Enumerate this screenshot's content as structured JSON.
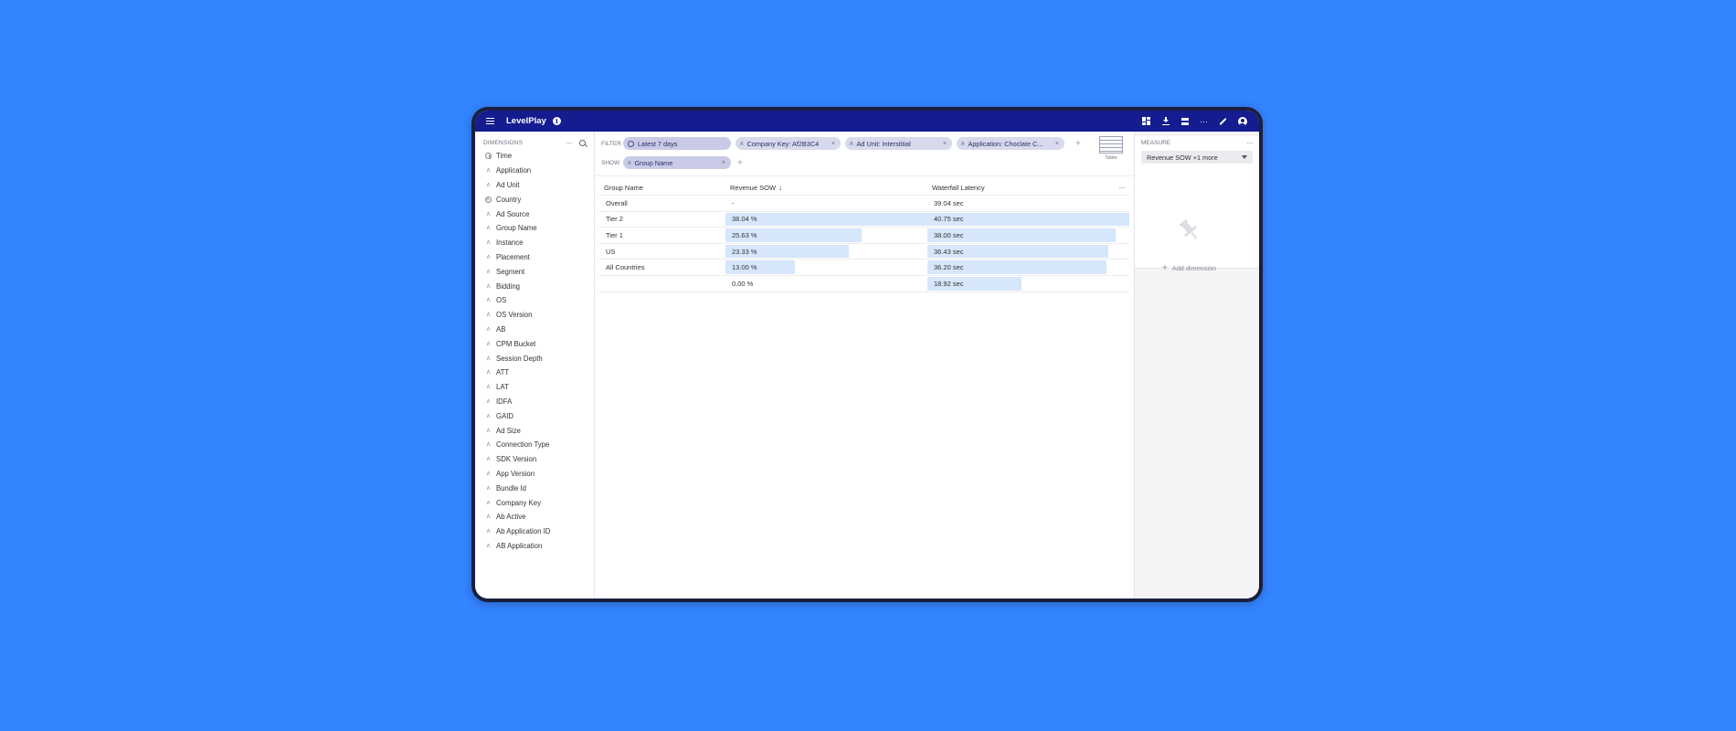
{
  "topbar": {
    "title": "LevelPlay",
    "info_icon": "info-icon",
    "actions": [
      "dashboard-icon",
      "download-icon",
      "stack-icon",
      "more-icon",
      "edit-icon",
      "account-icon"
    ]
  },
  "dimensions": {
    "title": "DIMENSIONS",
    "more": "···",
    "items": [
      {
        "label": "Time",
        "icon": "clock-icon"
      },
      {
        "label": "Application",
        "icon": "string-icon"
      },
      {
        "label": "Ad Unit",
        "icon": "string-icon"
      },
      {
        "label": "Country",
        "icon": "globe-icon"
      },
      {
        "label": "Ad Source",
        "icon": "string-icon"
      },
      {
        "label": "Group Name",
        "icon": "string-icon"
      },
      {
        "label": "Instance",
        "icon": "string-icon"
      },
      {
        "label": "Placement",
        "icon": "string-icon"
      },
      {
        "label": "Segment",
        "icon": "string-icon"
      },
      {
        "label": "Bidding",
        "icon": "string-icon"
      },
      {
        "label": "OS",
        "icon": "string-icon"
      },
      {
        "label": "OS Version",
        "icon": "string-icon"
      },
      {
        "label": "AB",
        "icon": "string-icon"
      },
      {
        "label": "CPM Bucket",
        "icon": "string-icon"
      },
      {
        "label": "Session Depth",
        "icon": "string-icon"
      },
      {
        "label": "ATT",
        "icon": "string-icon"
      },
      {
        "label": "LAT",
        "icon": "string-icon"
      },
      {
        "label": "IDFA",
        "icon": "string-icon"
      },
      {
        "label": "GAID",
        "icon": "string-icon"
      },
      {
        "label": "Ad Size",
        "icon": "string-icon"
      },
      {
        "label": "Connection Type",
        "icon": "string-icon"
      },
      {
        "label": "SDK Version",
        "icon": "string-icon"
      },
      {
        "label": "App Version",
        "icon": "string-icon"
      },
      {
        "label": "Bundle Id",
        "icon": "string-icon"
      },
      {
        "label": "Company Key",
        "icon": "string-icon"
      },
      {
        "label": "Ab Active",
        "icon": "string-icon"
      },
      {
        "label": "Ab Application ID",
        "icon": "string-icon"
      },
      {
        "label": "AB Application",
        "icon": "string-icon"
      }
    ]
  },
  "filter": {
    "label": "FILTER",
    "pills": [
      {
        "text": "Latest 7 days",
        "icon": "clock-icon"
      },
      {
        "text": "Company Key: Af2B3C4",
        "icon": "string-icon",
        "close": "×"
      },
      {
        "text": "Ad Unit: Interstitial",
        "icon": "string-icon",
        "close": "×"
      },
      {
        "text": "Application: Choclate C...",
        "icon": "string-icon",
        "close": "×"
      }
    ],
    "add": "+"
  },
  "show": {
    "label": "SHOW",
    "pills": [
      {
        "text": "Group Name",
        "icon": "string-icon",
        "close": "×"
      }
    ],
    "add": "+"
  },
  "viz": {
    "label": "Table",
    "icon": "table-icon"
  },
  "table": {
    "headers": [
      "Group Name",
      "Revenue SOW",
      "Waterfall Latency"
    ],
    "sort_icon": "↓",
    "more": "···",
    "rows": [
      {
        "name": "Overall",
        "revenue": "-",
        "revenue_frac": 0,
        "latency": "39.04 sec",
        "latency_frac": 0
      },
      {
        "name": "Tier 2",
        "revenue": "38.04 %",
        "revenue_frac": 1.0,
        "latency": "40.75 sec",
        "latency_frac": 1.0
      },
      {
        "name": "Tier 1",
        "revenue": "25.63 %",
        "revenue_frac": 0.674,
        "latency": "38.00 sec",
        "latency_frac": 0.933
      },
      {
        "name": "US",
        "revenue": "23.33 %",
        "revenue_frac": 0.613,
        "latency": "36.43 sec",
        "latency_frac": 0.894
      },
      {
        "name": "All Countries",
        "revenue": "13.00 %",
        "revenue_frac": 0.342,
        "latency": "36.20 sec",
        "latency_frac": 0.888
      },
      {
        "name": "",
        "revenue": "0.00 %",
        "revenue_frac": 0,
        "latency": "18.92 sec",
        "latency_frac": 0.464
      }
    ]
  },
  "measure": {
    "title": "MEASURE",
    "more": "···",
    "selected": "Revenue SOW +1 more",
    "add_dimension": "Add dimension",
    "add_icon": "+",
    "pin_icon": "pin-icon"
  }
}
